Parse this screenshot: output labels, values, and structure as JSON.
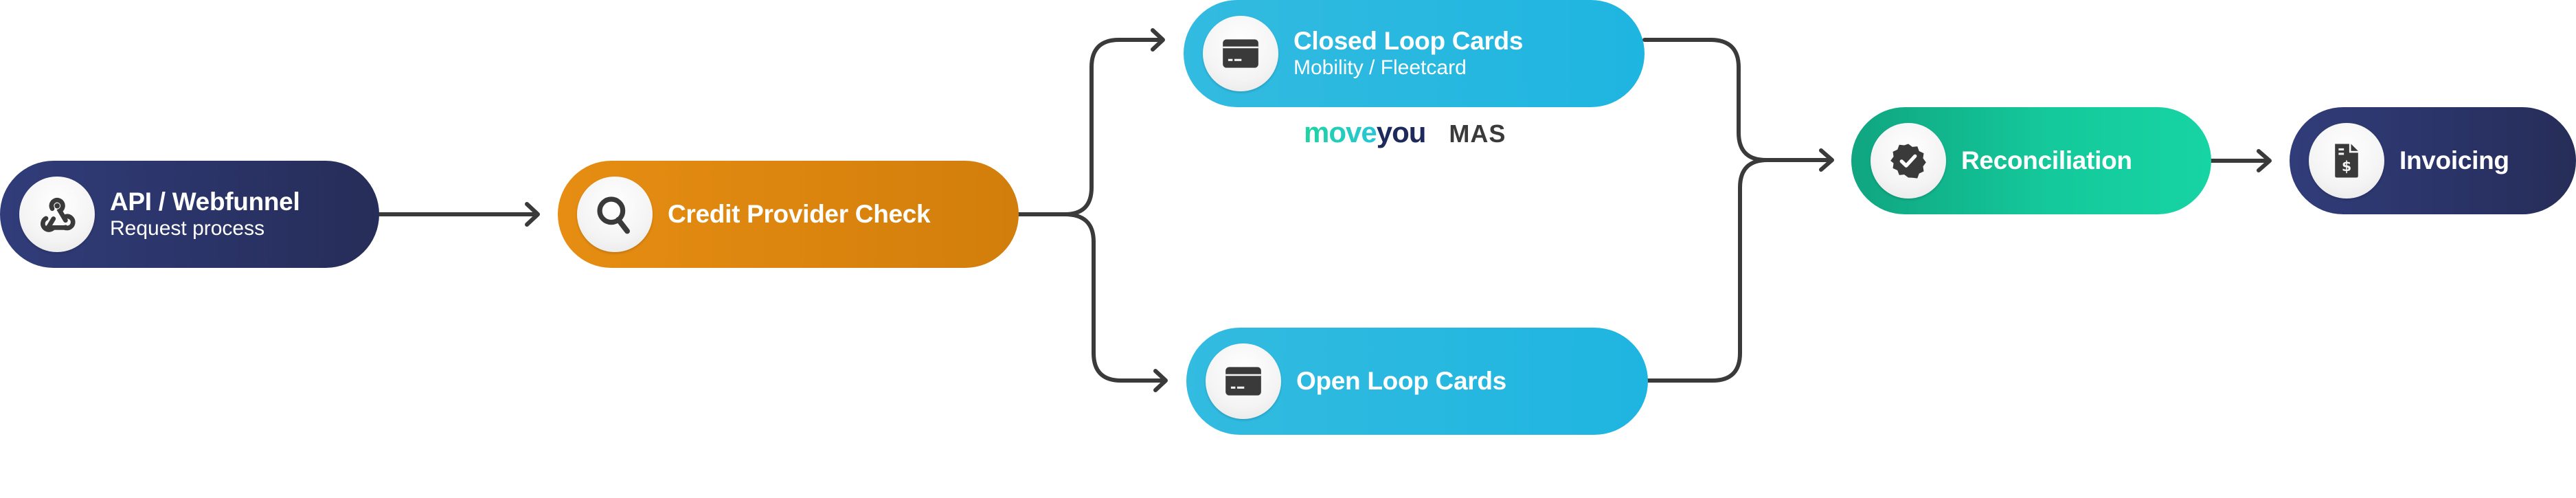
{
  "diagram": {
    "type": "process-flow",
    "nodes": [
      {
        "id": "api",
        "title": "API / Webfunnel",
        "subtitle": "Request process",
        "icon": "webhook-icon",
        "color": "#2c356b"
      },
      {
        "id": "credit",
        "title": "Credit Provider Check",
        "subtitle": null,
        "icon": "search-icon",
        "color": "#dd870f"
      },
      {
        "id": "closed",
        "title": "Closed Loop Cards",
        "subtitle": "Mobility / Fleetcard",
        "icon": "credit-card-icon",
        "color": "#22b6e0"
      },
      {
        "id": "open",
        "title": "Open Loop Cards",
        "subtitle": null,
        "icon": "credit-card-icon",
        "color": "#22b6e0"
      },
      {
        "id": "recon",
        "title": "Reconciliation",
        "subtitle": null,
        "icon": "verified-badge-icon",
        "color": "#13bf93"
      },
      {
        "id": "invoice",
        "title": "Invoicing",
        "subtitle": null,
        "icon": "invoice-dollar-icon",
        "color": "#2c356b"
      }
    ],
    "edges": [
      {
        "from": "api",
        "to": "credit"
      },
      {
        "from": "credit",
        "to": "closed"
      },
      {
        "from": "credit",
        "to": "open"
      },
      {
        "from": "closed",
        "to": "recon"
      },
      {
        "from": "open",
        "to": "recon"
      },
      {
        "from": "recon",
        "to": "invoice"
      }
    ],
    "partner_logos": {
      "moveyou_part1": "move",
      "moveyou_part2": "you",
      "mas": "MAS"
    }
  }
}
